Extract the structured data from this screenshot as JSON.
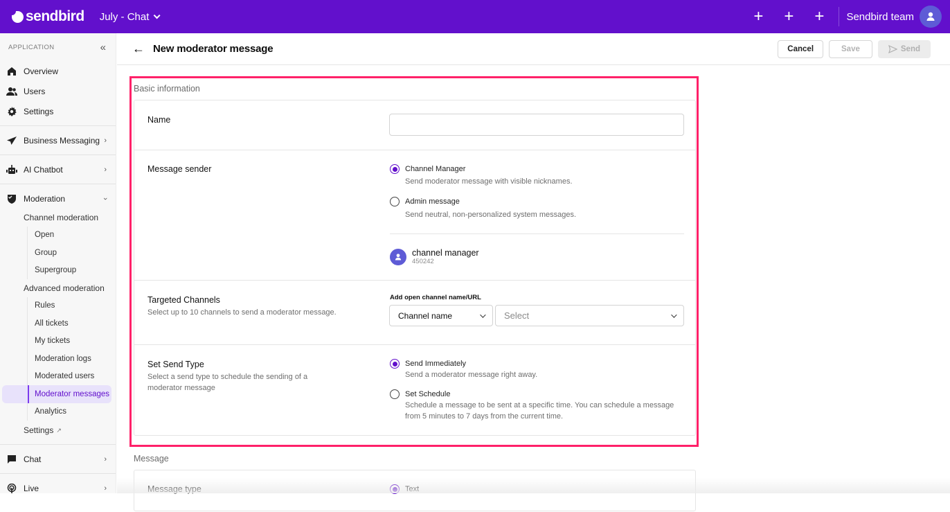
{
  "topbar": {
    "brand": "sendbird",
    "app_name": "July - Chat",
    "plus_buttons": [
      "+",
      "+",
      "+"
    ],
    "team_name": "Sendbird team",
    "brand_color": "#6210cc"
  },
  "sidebar": {
    "section_label": "APPLICATION",
    "collapse_icon": "«",
    "items": [
      {
        "label": "Overview",
        "icon": "home-icon"
      },
      {
        "label": "Users",
        "icon": "users-icon"
      },
      {
        "label": "Settings",
        "icon": "gear-icon"
      },
      {
        "label": "Business Messaging",
        "icon": "paper-plane-icon"
      },
      {
        "label": "AI Chatbot",
        "icon": "robot-icon"
      },
      {
        "label": "Moderation",
        "icon": "shield-icon"
      }
    ],
    "moderation": {
      "channel_moderation": {
        "label": "Channel moderation",
        "children": [
          "Open",
          "Group",
          "Supergroup"
        ]
      },
      "advanced_moderation": {
        "label": "Advanced moderation",
        "children": [
          "Rules",
          "All tickets",
          "My tickets",
          "Moderation logs",
          "Moderated users",
          "Moderator messages",
          "Analytics"
        ],
        "active": "Moderator messages"
      },
      "settings_label": "Settings",
      "settings_suffix": "↗"
    },
    "bottom_items": [
      {
        "label": "Chat",
        "icon": "chat-bubble-icon"
      },
      {
        "label": "Live",
        "icon": "broadcast-icon"
      }
    ]
  },
  "header": {
    "title": "New moderator message",
    "cancel_label": "Cancel",
    "save_label": "Save",
    "send_label": "Send"
  },
  "basic_info": {
    "section_label": "Basic information",
    "name": {
      "label": "Name",
      "value": "",
      "placeholder": ""
    },
    "message_sender": {
      "label": "Message sender",
      "options": [
        {
          "label": "Channel Manager",
          "desc": "Send moderator message with visible nicknames.",
          "selected": true
        },
        {
          "label": "Admin message",
          "desc": "Send neutral, non-personalized system messages.",
          "selected": false
        }
      ],
      "manager": {
        "name": "channel manager",
        "id": "450242"
      }
    },
    "targeted_channels": {
      "label": "Targeted Channels",
      "desc": "Select up to 10 channels to send a moderator message.",
      "field_label": "Add open channel name/URL",
      "type_select": "Channel name",
      "channel_select_placeholder": "Select"
    },
    "send_type": {
      "label": "Set Send Type",
      "desc": "Select a send type to schedule the sending of a moderator message",
      "options": [
        {
          "label": "Send Immediately",
          "desc": "Send a moderator message right away.",
          "selected": true
        },
        {
          "label": "Set Schedule",
          "desc": "Schedule a message to be sent at a specific time. You can schedule a message from 5 minutes to 7 days from the current time.",
          "selected": false
        }
      ]
    }
  },
  "message": {
    "section_label": "Message",
    "message_type": {
      "label": "Message type",
      "options": [
        {
          "label": "Text",
          "selected": true
        }
      ]
    }
  },
  "highlight_color": "#ff2169"
}
